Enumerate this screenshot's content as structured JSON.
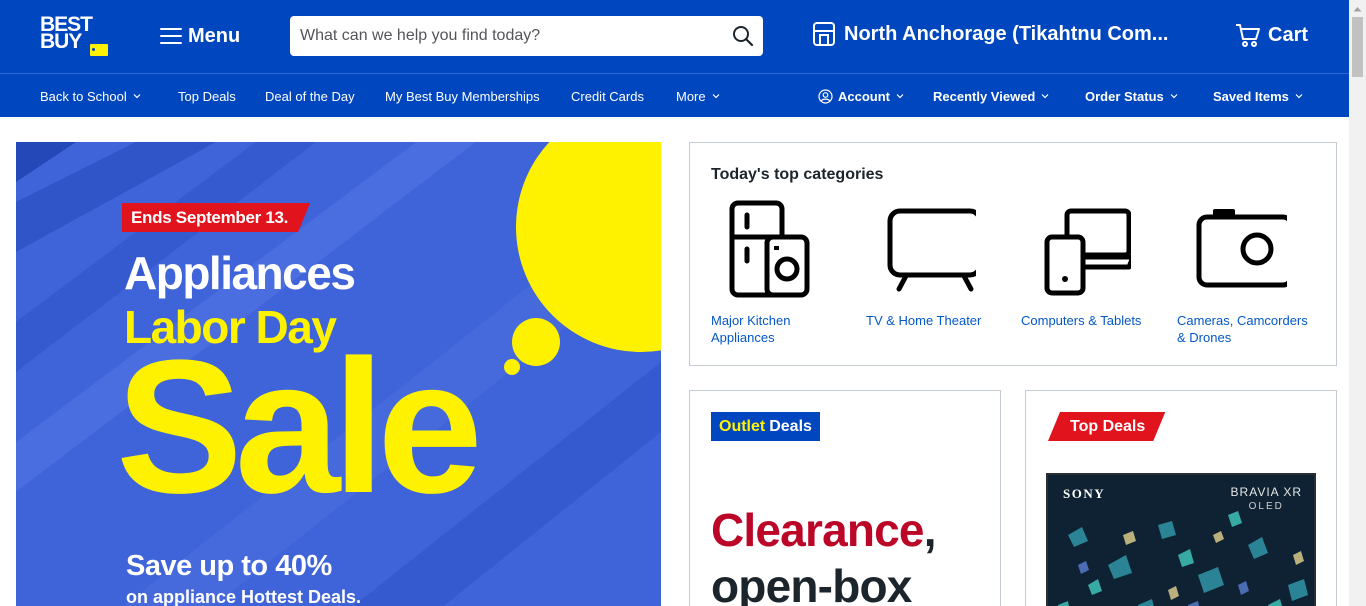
{
  "header": {
    "logo_text_line1": "BEST",
    "logo_text_line2": "BUY",
    "menu_label": "Menu",
    "search_placeholder": "What can we help you find today?",
    "store_label": "North Anchorage (Tikahtnu Com...",
    "cart_label": "Cart",
    "brand_color": "#0046be",
    "accent_color": "#fff200"
  },
  "nav": {
    "left": [
      {
        "label": "Back to School",
        "dropdown": true
      },
      {
        "label": "Top Deals",
        "dropdown": false
      },
      {
        "label": "Deal of the Day",
        "dropdown": false
      },
      {
        "label": "My Best Buy Memberships",
        "dropdown": false
      },
      {
        "label": "Credit Cards",
        "dropdown": false
      },
      {
        "label": "More",
        "dropdown": true
      }
    ],
    "right": [
      {
        "label": "Account",
        "icon": "user-circle-icon",
        "dropdown": true
      },
      {
        "label": "Recently Viewed",
        "dropdown": true
      },
      {
        "label": "Order Status",
        "dropdown": true
      },
      {
        "label": "Saved Items",
        "dropdown": true
      }
    ]
  },
  "hero": {
    "ends_tag": "Ends September 13.",
    "line1": "Appliances",
    "line2": "Labor Day",
    "big": "Sale",
    "save": "Save up to 40%",
    "sub": "on appliance Hottest Deals."
  },
  "categories": {
    "title": "Today's top categories",
    "items": [
      {
        "label": "Major Kitchen Appliances",
        "icon": "appliances-icon"
      },
      {
        "label": "TV & Home Theater",
        "icon": "tv-icon"
      },
      {
        "label": "Computers & Tablets",
        "icon": "computer-tablet-icon"
      },
      {
        "label": "Cameras, Camcorders & Drones",
        "icon": "camera-icon"
      }
    ]
  },
  "outlet": {
    "tag_highlight": "Outlet",
    "tag_rest": "Deals",
    "headline_word": "Clearance",
    "headline_comma": ",",
    "headline_line2": "open-box"
  },
  "top_deals": {
    "tag": "Top Deals",
    "tv_brand": "SONY",
    "tv_model": "BRAVIA XR",
    "tv_sub": "OLED"
  }
}
